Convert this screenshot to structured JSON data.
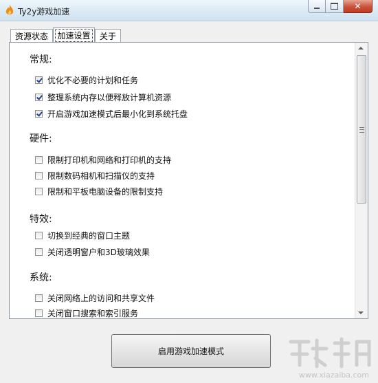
{
  "window": {
    "title": "Ty2y游戏加速"
  },
  "tabs": [
    {
      "label": "资源状态"
    },
    {
      "label": "加速设置"
    },
    {
      "label": "关于"
    }
  ],
  "sections": {
    "general": {
      "title": "常规:",
      "options": [
        {
          "label": "优化不必要的计划和任务",
          "checked": true
        },
        {
          "label": "整理系统内存以便释放计算机资源",
          "checked": true
        },
        {
          "label": "开启游戏加速模式后最小化到系统托盘",
          "checked": true
        }
      ]
    },
    "hardware": {
      "title": "硬件:",
      "options": [
        {
          "label": "限制打印机和网络和打印机的支持",
          "checked": false
        },
        {
          "label": "限制数码相机和扫描仪的支持",
          "checked": false
        },
        {
          "label": "限制和平板电脑设备的限制支持",
          "checked": false
        }
      ]
    },
    "effects": {
      "title": "特效:",
      "options": [
        {
          "label": "切换到经典的窗口主题",
          "checked": false
        },
        {
          "label": "关闭透明窗户和3D玻璃效果",
          "checked": false
        }
      ]
    },
    "system": {
      "title": "系统:",
      "options": [
        {
          "label": "关闭网络上的访问和共享文件",
          "checked": false
        },
        {
          "label": "关闭窗口搜索和索引服务",
          "checked": false
        }
      ]
    }
  },
  "actions": {
    "start_label": "启用游戏加速模式"
  },
  "watermark": {
    "text": "www.xiazaiba.com"
  },
  "colors": {
    "titlebar": "#dcebf5",
    "close_button": "#c8523c",
    "checkmark": "#1d3f8a"
  }
}
